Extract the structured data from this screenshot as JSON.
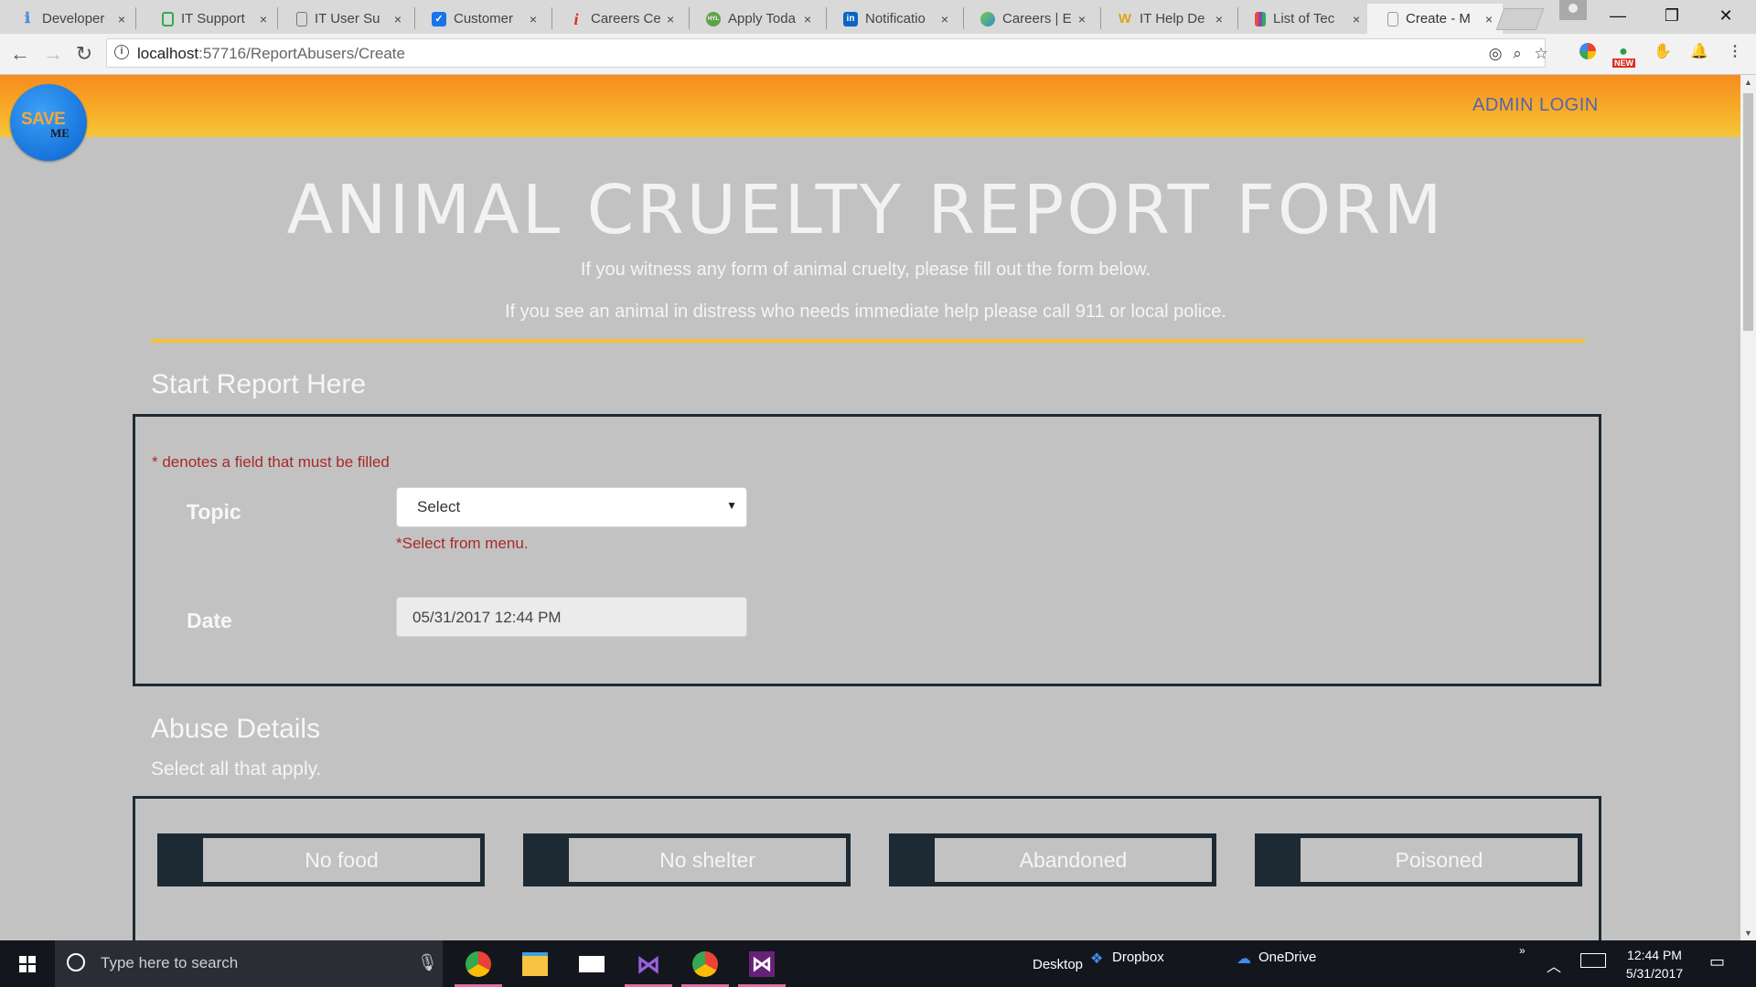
{
  "browser": {
    "tabs": [
      {
        "label": "Developer",
        "icon": "info-i-icon",
        "color": "#4a90d9"
      },
      {
        "label": "IT Support",
        "icon": "green-doc-icon",
        "color": "#34a853"
      },
      {
        "label": "IT User Su",
        "icon": "doc-icon",
        "color": "#777777"
      },
      {
        "label": "Customer",
        "icon": "checkbox-icon",
        "color": "#1a73e8"
      },
      {
        "label": "Careers Ce",
        "icon": "red-i-icon",
        "color": "#d93025"
      },
      {
        "label": "Apply Toda",
        "icon": "hyl-icon",
        "color": "#5fa14a"
      },
      {
        "label": "Notificatio",
        "icon": "linkedin-icon",
        "color": "#0a66c2"
      },
      {
        "label": "Careers | E",
        "icon": "globe-icon",
        "color": "#2b8fd6"
      },
      {
        "label": "IT Help De",
        "icon": "w-icon",
        "color": "#e0a31a"
      },
      {
        "label": "List of Tec",
        "icon": "chart-icon",
        "color": "#8e44ad"
      },
      {
        "label": "Create - M",
        "icon": "page-icon",
        "color": "#999999",
        "active": true
      }
    ],
    "tab_close": "×",
    "window_controls": {
      "minimize": "—",
      "restore": "❐",
      "close": "✕"
    },
    "url_host": "localhost",
    "url_path": ":57716/ReportAbusers/Create",
    "nav": {
      "back": "←",
      "forward": "→",
      "reload": "↻"
    },
    "new_badge": "NEW"
  },
  "site": {
    "logo_line1": "SAVE",
    "logo_line2": "ME",
    "admin_login": "ADMIN LOGIN"
  },
  "form": {
    "title": "ANIMAL CRUELTY REPORT FORM",
    "intro1": "If you witness any form of animal cruelty, please fill out the form below.",
    "intro2": "If you see an animal in distress who needs immediate help please call 911 or local police.",
    "start_heading": "Start Report Here",
    "required_note": "* denotes a field that must be filled",
    "topic_label": "Topic",
    "topic_value": "Select",
    "topic_error": "*Select from menu.",
    "date_label": "Date",
    "date_value": "05/31/2017 12:44 PM",
    "abuse_heading": "Abuse Details",
    "abuse_sub": "Select all that apply.",
    "abuse_options": [
      "No food",
      "No shelter",
      "Abandoned",
      "Poisoned"
    ]
  },
  "taskbar": {
    "search_placeholder": "Type here to search",
    "desktop_label": "Desktop",
    "dropbox_label": "Dropbox",
    "onedrive_label": "OneDrive",
    "time": "12:44 PM",
    "date": "5/31/2017"
  },
  "colors": {
    "accent_gold": "#f1c232",
    "header_orange": "#f78c1e",
    "error_red": "#a72a2a",
    "panel_border": "#1d2a33",
    "admin_blue": "#5564ae"
  }
}
